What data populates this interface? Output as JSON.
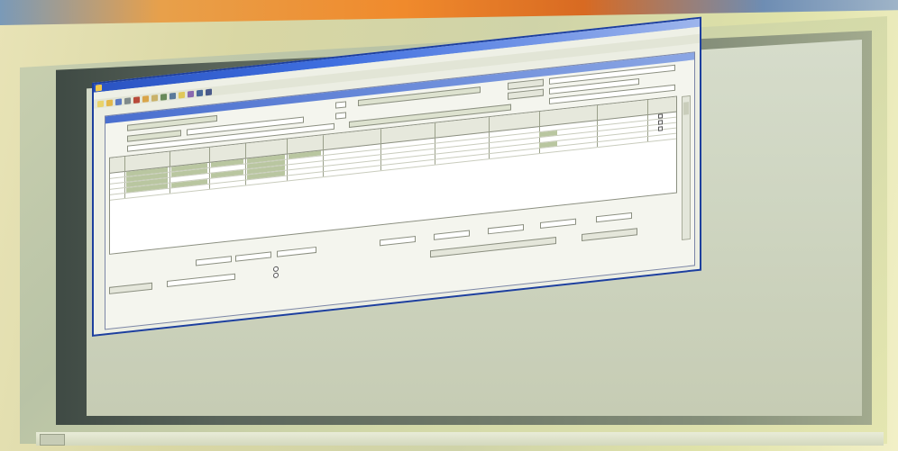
{
  "scene": {
    "colors": {
      "wall": "#dfe2a8",
      "bezel": "#6e7868",
      "window_frame": "#1d3f9e",
      "titlebar": "#2a53c2",
      "grid_fill": "#b9c6a0"
    }
  },
  "app": {
    "title": "",
    "toolbar_icons": [
      "new-icon",
      "open-icon",
      "save-icon",
      "print-icon",
      "cut-icon",
      "copy-icon",
      "paste-icon",
      "undo-icon",
      "redo-icon",
      "find-icon",
      "filter-icon",
      "sort-icon",
      "help-icon"
    ]
  },
  "document": {
    "title": "",
    "grid": {
      "row_count": 6,
      "column_count": 13
    }
  },
  "taskbar": {
    "start_label": ""
  }
}
